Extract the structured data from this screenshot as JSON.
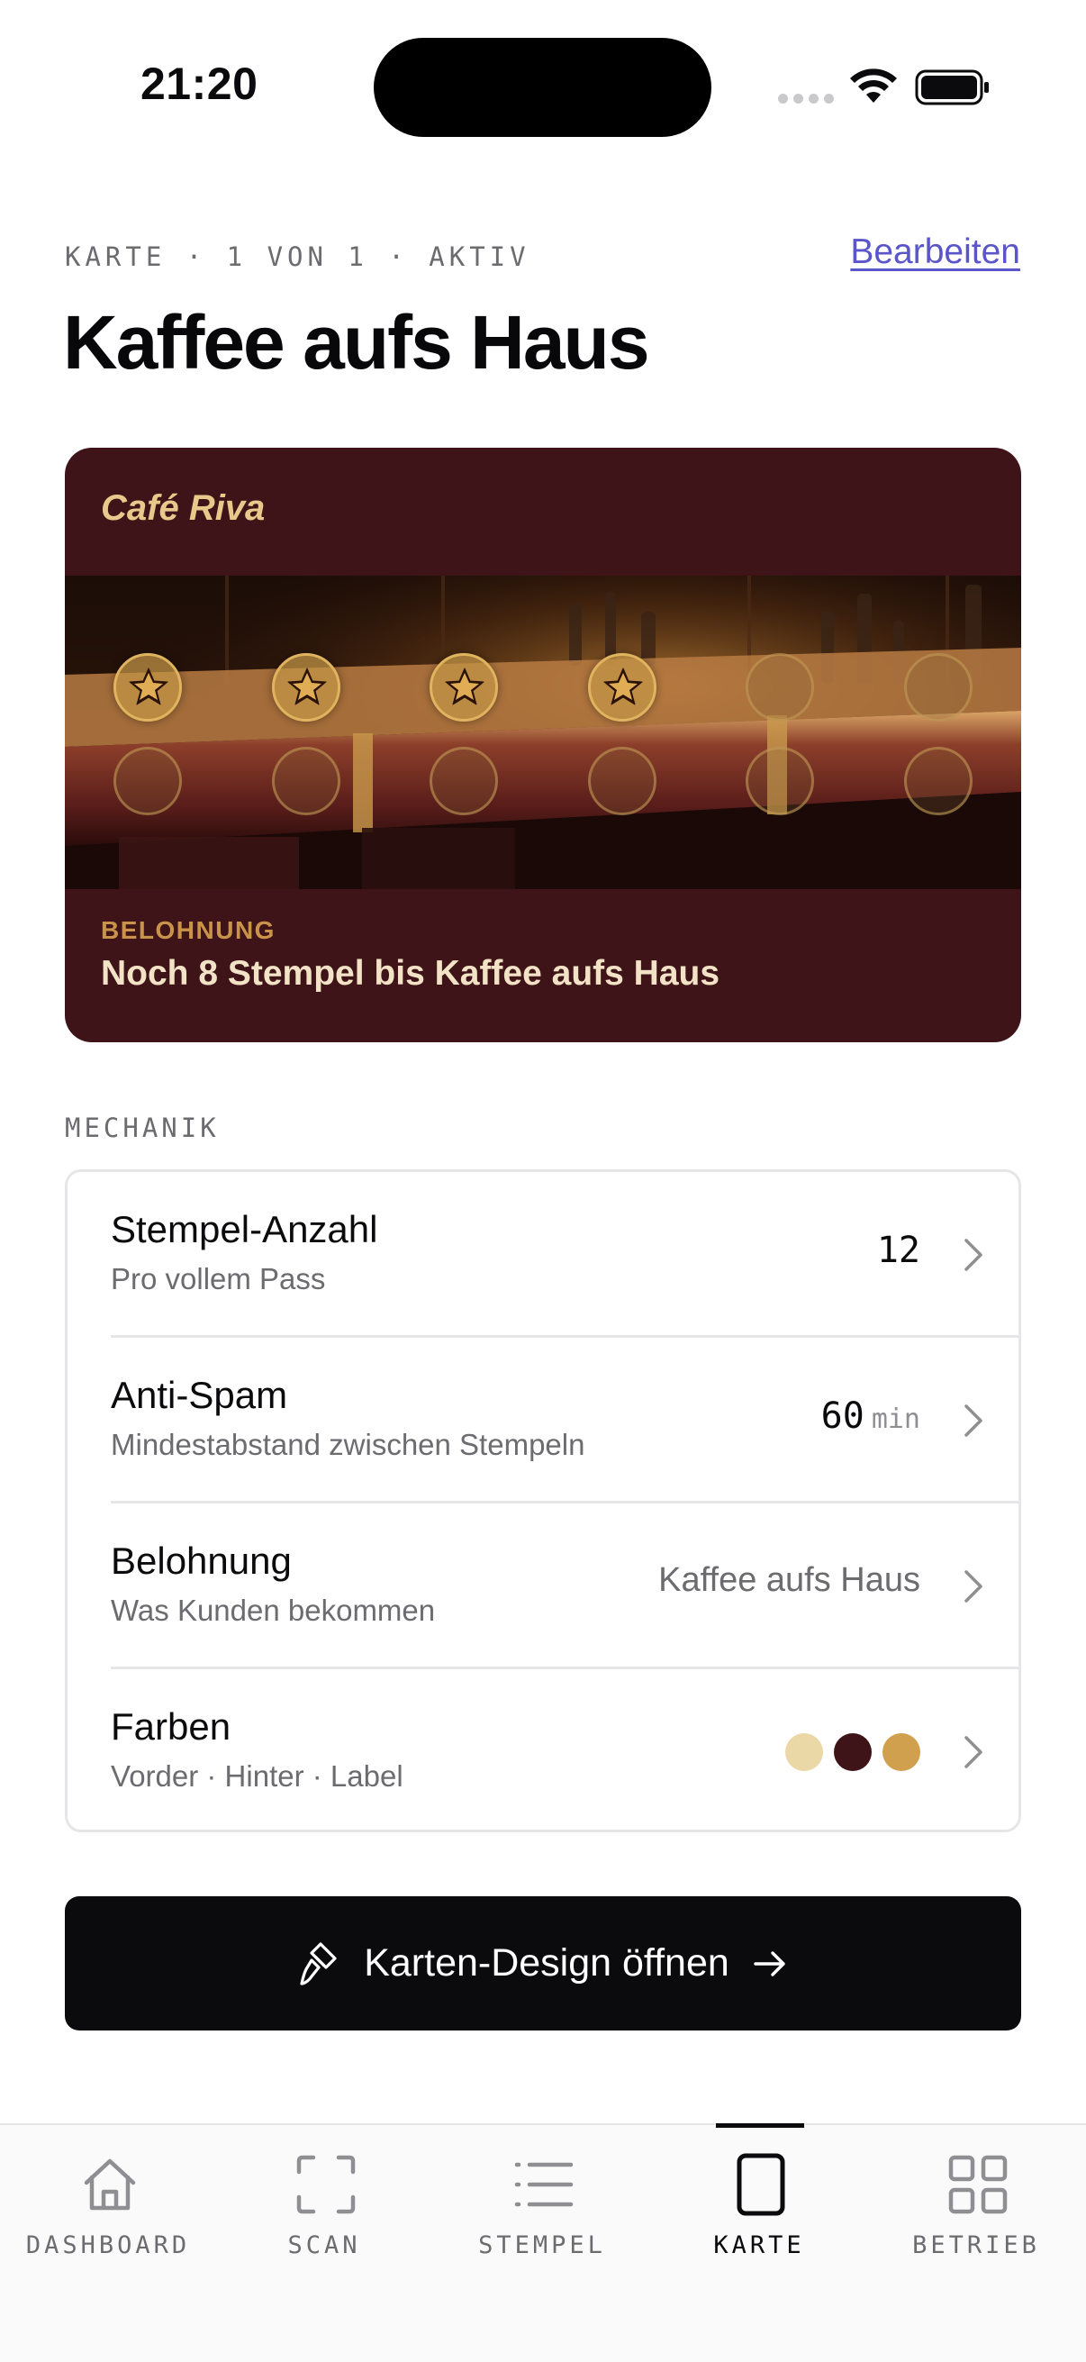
{
  "status_bar": {
    "time": "21:20"
  },
  "header": {
    "eyebrow": "KARTE · 1 VON 1 · AKTIV",
    "edit_label": "Bearbeiten",
    "title": "Kaffee aufs Haus"
  },
  "card": {
    "brand": "Café Riva",
    "stamps_total": 12,
    "stamps_collected": 4,
    "reward_label": "BELOHNUNG",
    "reward_text": "Noch 8 Stempel bis Kaffee aufs Haus",
    "colors": {
      "background": "#3f1419",
      "accent": "#c9944a",
      "label": "#e8c98b"
    }
  },
  "mechanics": {
    "section_label": "MECHANIK",
    "rows": [
      {
        "title": "Stempel-Anzahl",
        "subtitle": "Pro vollem Pass",
        "value": "12"
      },
      {
        "title": "Anti-Spam",
        "subtitle": "Mindestabstand zwischen Stempeln",
        "value": "60",
        "unit": "min"
      },
      {
        "title": "Belohnung",
        "subtitle": "Was Kunden bekommen",
        "value": "Kaffee aufs Haus"
      },
      {
        "title": "Farben",
        "subtitle": "Vorder · Hinter · Label",
        "swatches": [
          "#ead8a6",
          "#3f1419",
          "#d0a04e"
        ]
      }
    ]
  },
  "cta": {
    "label": "Karten-Design öffnen",
    "icon": "paint-brush-icon",
    "trailing_icon": "arrow-right-icon"
  },
  "tabbar": {
    "tabs": [
      {
        "label": "DASHBOARD",
        "icon": "home-icon"
      },
      {
        "label": "SCAN",
        "icon": "scan-icon"
      },
      {
        "label": "STEMPEL",
        "icon": "list-icon"
      },
      {
        "label": "KARTE",
        "icon": "card-icon",
        "active": true
      },
      {
        "label": "BETRIEB",
        "icon": "grid-icon"
      }
    ]
  }
}
